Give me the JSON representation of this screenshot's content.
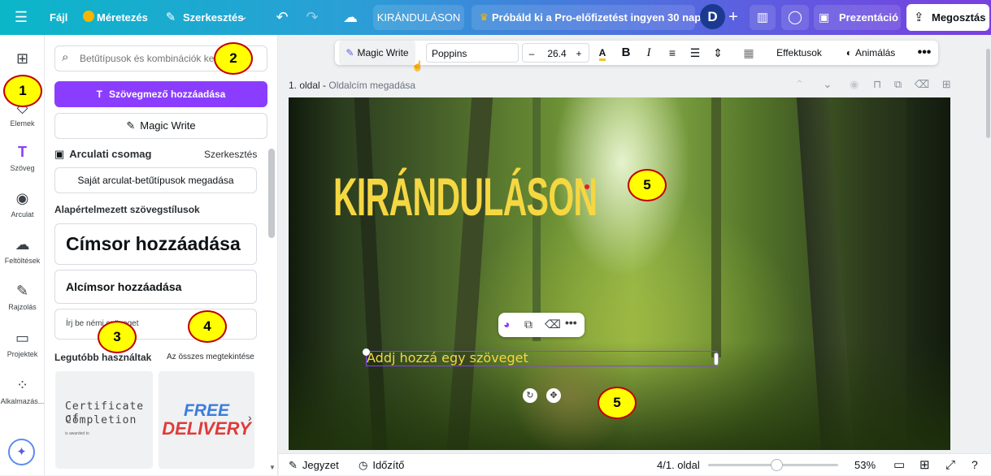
{
  "topbar": {
    "menu_icon": "hamburger-icon",
    "file": "Fájl",
    "resize": "Méretezés",
    "edit": "Szerkesztés",
    "doc_title": "KIRÁNDULÁSON",
    "pro_trial": "Próbáld ki a Pro-előfizetést ingyen 30 napig",
    "avatar_letter": "D",
    "present": "Prezentáció",
    "share": "Megosztás"
  },
  "rail": [
    {
      "label": "",
      "icon": "layout-icon"
    },
    {
      "label": "Elemek",
      "icon": "shapes-icon"
    },
    {
      "label": "Szöveg",
      "icon": "text-icon"
    },
    {
      "label": "Arculat",
      "icon": "brand-icon"
    },
    {
      "label": "Feltöltések",
      "icon": "upload-icon"
    },
    {
      "label": "Rajzolás",
      "icon": "draw-icon"
    },
    {
      "label": "Projektek",
      "icon": "folder-icon"
    },
    {
      "label": "Alkalmazás...",
      "icon": "apps-icon"
    }
  ],
  "panel": {
    "search_placeholder": "Betűtípusok és kombinációk ke",
    "add_textbox": "Szövegmező hozzáadása",
    "magic_write": "Magic Write",
    "brand_kit": "Arculati csomag",
    "brand_edit": "Szerkesztés",
    "brand_fonts": "Saját arculat-betűtípusok megadása",
    "default_styles": "Alapértelmezett szövegstílusok",
    "heading": "Címsor hozzáadása",
    "subheading": "Alcímsor hozzáadása",
    "body_text": "Írj be némi szöveget",
    "recent": "Legutóbb használtak",
    "see_all": "Az összes megtekintése",
    "thumb1_line1": "Certificate of",
    "thumb1_line2": "Completion",
    "thumb1_small": "is awarded to",
    "thumb2_line1": "FREE",
    "thumb2_line2": "DELIVERY"
  },
  "toolbar": {
    "magic_write": "Magic Write",
    "font": "Poppins",
    "minus": "–",
    "size": "26.4",
    "plus": "+",
    "effects": "Effektusok",
    "animate": "Animálás"
  },
  "page": {
    "label": "1. oldal -",
    "title_placeholder": "Oldalcím megadása"
  },
  "canvas": {
    "headline": "KIRÁNDULÁSON",
    "placeholder": "Addj hozzá egy szöveget"
  },
  "markers": [
    "1",
    "2",
    "3",
    "4",
    "5",
    "5"
  ],
  "bottombar": {
    "notes": "Jegyzet",
    "timer": "Időzítő",
    "page_count": "4/1. oldal",
    "zoom": "53%",
    "zoom_fraction": 0.53
  },
  "colors": {
    "accent": "#8b3dff",
    "headline": "#f5d742",
    "marker_fill": "#ffff00",
    "marker_border": "#c00000"
  }
}
